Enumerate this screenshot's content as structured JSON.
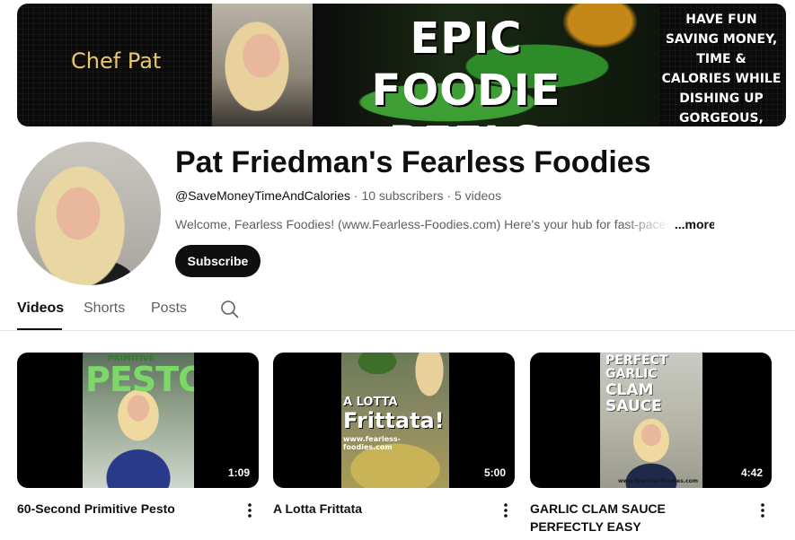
{
  "banner": {
    "chef_name": "Chef Pat",
    "headline_line1": "EPIC FOODIE",
    "headline_line2": "REELS",
    "tagline": "HAVE FUN SAVING MONEY, TIME & CALORIES WHILE DISHING UP GORGEOUS, HEALTHY DISHES"
  },
  "channel": {
    "title": "Pat Friedman's Fearless Foodies",
    "handle": "@SaveMoneyTimeAndCalories",
    "subscribers": "10 subscribers",
    "videos_count": "5 videos",
    "separator": "·",
    "description": "Welcome, Fearless Foodies! (www.Fearless-Foodies.com) Here's your hub for fast-paced",
    "more_label": "...more",
    "subscribe_label": "Subscribe"
  },
  "tabs": [
    {
      "label": "Videos",
      "active": true
    },
    {
      "label": "Shorts",
      "active": false
    },
    {
      "label": "Posts",
      "active": false
    }
  ],
  "icons": {
    "search": "search-icon",
    "more": "more-vert-icon"
  },
  "videos": [
    {
      "title": "60-Second Primitive Pesto",
      "duration": "1:09",
      "thumb_text_top": "PRIMITIVE",
      "thumb_text_main": "PESTO"
    },
    {
      "title": "A Lotta Frittata",
      "duration": "5:00",
      "thumb_text_top": "A LOTTA",
      "thumb_text_main": "Frittata!",
      "thumb_text_url": "www.fearless-foodies.com"
    },
    {
      "title": "GARLIC CLAM SAUCE PERFECTLY EASY",
      "duration": "4:42",
      "thumb_text_top": "PERFECT GARLIC",
      "thumb_text_main": "CLAM SAUCE",
      "thumb_text_url": "www.fearless-foodies.com"
    }
  ],
  "colors": {
    "accent_dark": "#0f0f0f",
    "muted_text": "#606060",
    "chef_name_gold": "#e8c86a"
  }
}
